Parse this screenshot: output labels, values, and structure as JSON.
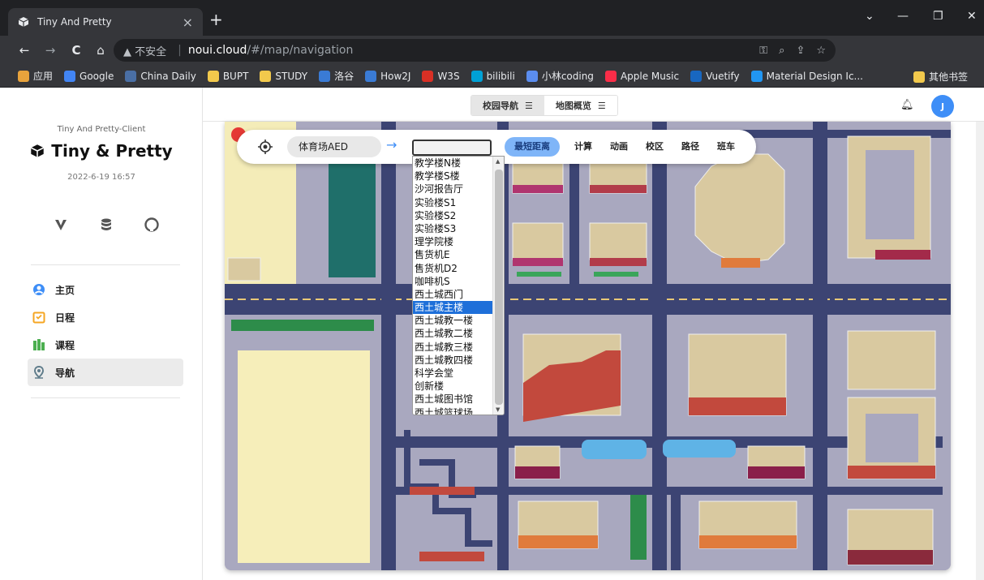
{
  "browser": {
    "tab_title": "Tiny And Pretty",
    "tab_close": "×",
    "new_tab": "+",
    "controls": {
      "minimize": "—",
      "restore": "❐",
      "close": "✕",
      "menu": "⌄"
    },
    "nav": {
      "back": "←",
      "forward": "→",
      "reload": "C",
      "home": "⌂"
    },
    "security": "▲ 不安全",
    "host": "noui.cloud",
    "path": "/#/map/navigation",
    "omnibox_actions": [
      "⚿",
      "⌕",
      "⇪",
      "☆"
    ],
    "bookmarks": [
      {
        "label": "应用",
        "color": "#e8a33c"
      },
      {
        "label": "Google",
        "color": "#4285f4"
      },
      {
        "label": "China Daily",
        "color": "#4a6fa5"
      },
      {
        "label": "BUPT",
        "color": "#f2c94c"
      },
      {
        "label": "STUDY",
        "color": "#f2c94c"
      },
      {
        "label": "洛谷",
        "color": "#3a7bd5"
      },
      {
        "label": "How2J",
        "color": "#3a7bd5"
      },
      {
        "label": "W3S",
        "color": "#d93025"
      },
      {
        "label": "bilibili",
        "color": "#00a1d6"
      },
      {
        "label": "小林coding",
        "color": "#5b8def"
      },
      {
        "label": "Apple Music",
        "color": "#fa2d48"
      },
      {
        "label": "Vuetify",
        "color": "#1867c0"
      },
      {
        "label": "Material Design Ic...",
        "color": "#2196f3"
      }
    ],
    "bookmarks_other": "其他书签"
  },
  "sidebar": {
    "subtitle": "Tiny And Pretty-Client",
    "title": "Tiny & Pretty",
    "datetime": "2022-6-19 16:57",
    "social_icons": [
      "vuetify-icon",
      "database-icon",
      "github-icon"
    ],
    "menu": [
      {
        "label": "主页",
        "icon": "user-circle-icon",
        "color": "#3e8ef7",
        "active": false
      },
      {
        "label": "日程",
        "icon": "calendar-icon",
        "color": "#f5a623",
        "active": false
      },
      {
        "label": "课程",
        "icon": "books-icon",
        "color": "#4caf50",
        "active": false
      },
      {
        "label": "导航",
        "icon": "map-pin-icon",
        "color": "#607d8b",
        "active": true
      }
    ]
  },
  "topbar": {
    "tabs": [
      {
        "label": "校园导航",
        "active": true
      },
      {
        "label": "地图概览",
        "active": false
      }
    ],
    "avatar_initial": "J"
  },
  "navigation": {
    "from": "体育场AED",
    "to": "",
    "options": [
      {
        "label": "最短距离",
        "primary": true
      },
      {
        "label": "计算"
      },
      {
        "label": "动画"
      },
      {
        "label": "校区"
      },
      {
        "label": "路径"
      },
      {
        "label": "班车"
      }
    ],
    "dropdown_items": [
      "教学楼N楼",
      "教学楼S楼",
      "沙河报告厅",
      "实验楼S1",
      "实验楼S2",
      "实验楼S3",
      "理学院楼",
      "售货机E",
      "售货机D2",
      "咖啡机S",
      "西土城西门",
      "西土城主楼",
      "西土城教一楼",
      "西土城教二楼",
      "西土城教三楼",
      "西土城教四楼",
      "科学会堂",
      "创新楼",
      "西土城图书馆",
      "西土城篮球场"
    ],
    "selected_index": 11
  },
  "colors": {
    "road": "#3c4473",
    "ground": "#a9a8bf",
    "sand": "#d9c9a0",
    "brick": "#c2493d",
    "orange": "#e07b3c",
    "field": "#1f6f6a",
    "water": "#5fb3e6",
    "accent": "#3e8ef7"
  }
}
